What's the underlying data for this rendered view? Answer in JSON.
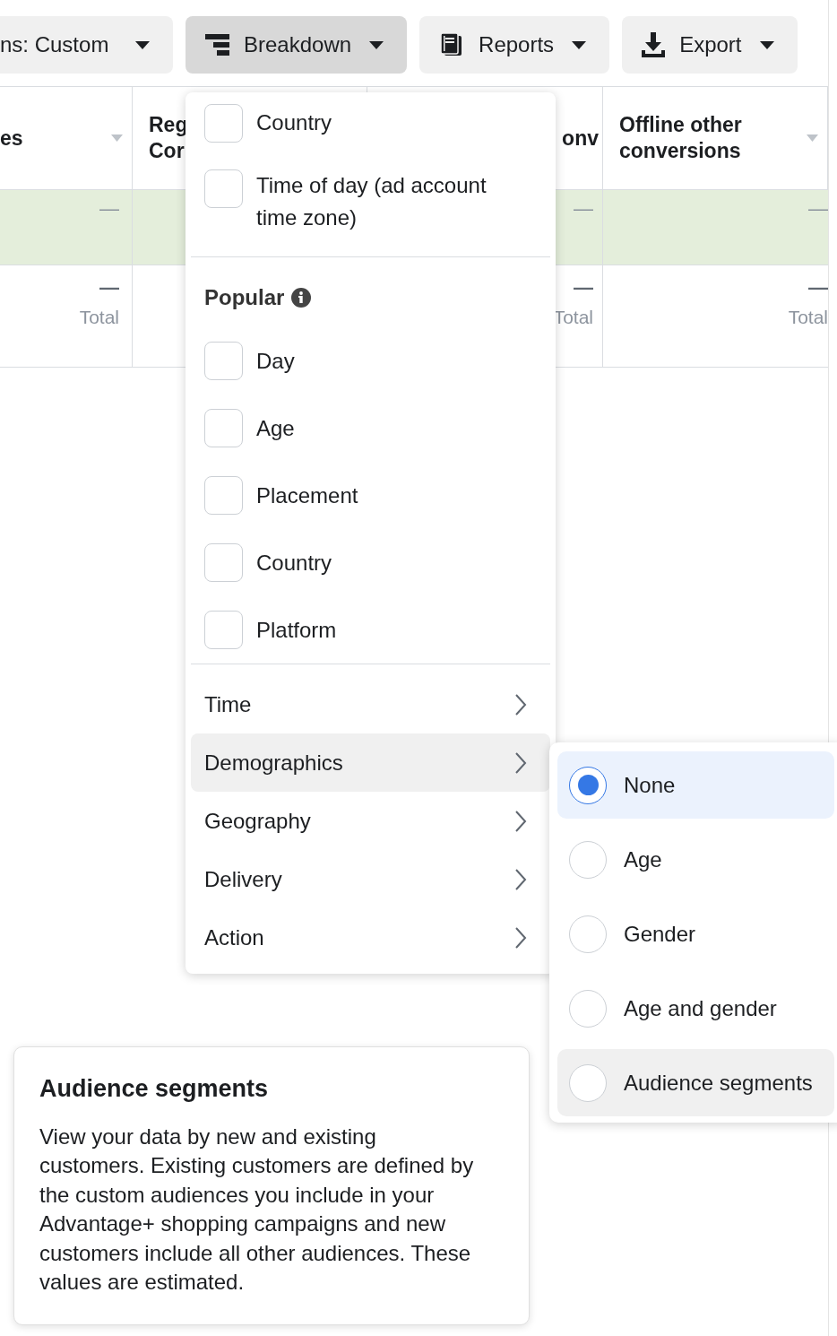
{
  "toolbar": {
    "buttons": [
      {
        "label": "ns: Custom",
        "active": false
      },
      {
        "label": "Breakdown",
        "active": true
      },
      {
        "label": "Reports",
        "active": false
      },
      {
        "label": "Export",
        "active": false
      }
    ]
  },
  "table": {
    "rows": [
      {
        "highlighted": true
      },
      {
        "highlighted": false
      }
    ],
    "columns": [
      {
        "header_lines": [
          "es"
        ],
        "sortable": true,
        "cells": [
          {
            "value": "—"
          },
          {
            "value": "—",
            "note": "Total"
          }
        ]
      },
      {
        "header_lines": [
          "Reg",
          "Cor"
        ],
        "sortable": false
      },
      {
        "header_lines": [
          "onv"
        ],
        "sortable": false,
        "cells": [
          {
            "value": "—"
          },
          {
            "value": "—",
            "note": "Total"
          }
        ]
      },
      {
        "header_lines": [
          "Offline other conversions"
        ],
        "sortable": true,
        "cells": [
          {
            "value": "—"
          },
          {
            "value": "—",
            "note": "Total"
          }
        ]
      }
    ]
  },
  "breakdown_menu": {
    "items": [
      {
        "kind": "checkbox",
        "label": "Country",
        "checked": false
      },
      {
        "kind": "checkbox",
        "label": "Time of day (ad account time zone)",
        "checked": false
      },
      {
        "kind": "divider"
      },
      {
        "kind": "header",
        "label": "Popular",
        "info": true
      },
      {
        "kind": "checkbox",
        "label": "Day",
        "checked": false
      },
      {
        "kind": "checkbox",
        "label": "Age",
        "checked": false
      },
      {
        "kind": "checkbox",
        "label": "Placement",
        "checked": false
      },
      {
        "kind": "checkbox",
        "label": "Country",
        "checked": false
      },
      {
        "kind": "checkbox",
        "label": "Platform",
        "checked": false
      },
      {
        "kind": "divider"
      },
      {
        "kind": "submenu",
        "label": "Time",
        "expanded": false
      },
      {
        "kind": "submenu",
        "label": "Demographics",
        "expanded": true
      },
      {
        "kind": "submenu",
        "label": "Geography",
        "expanded": false
      },
      {
        "kind": "submenu",
        "label": "Delivery",
        "expanded": false
      },
      {
        "kind": "submenu",
        "label": "Action",
        "expanded": false
      }
    ]
  },
  "demographics_submenu": {
    "options": [
      {
        "label": "None",
        "selected": true,
        "hovered": false
      },
      {
        "label": "Age",
        "selected": false,
        "hovered": false
      },
      {
        "label": "Gender",
        "selected": false,
        "hovered": false
      },
      {
        "label": "Age and gender",
        "selected": false,
        "hovered": false
      },
      {
        "label": "Audience segments",
        "selected": false,
        "hovered": true
      }
    ]
  },
  "tooltip": {
    "title": "Audience segments",
    "body": "View your data by new and existing customers. Existing customers are defined by the custom audiences you include in your Advantage+ shopping campaigns and new customers include all other audiences. These values are estimated."
  }
}
